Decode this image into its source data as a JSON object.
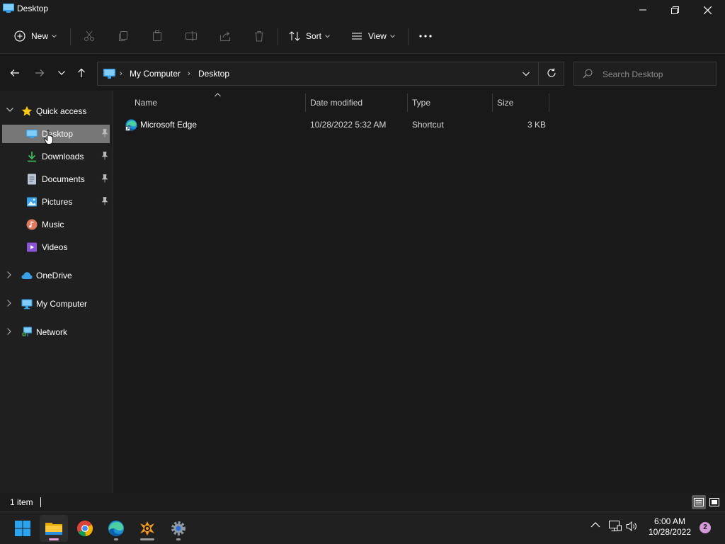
{
  "window": {
    "title": "Desktop"
  },
  "toolbar": {
    "new_label": "New",
    "sort_label": "Sort",
    "view_label": "View",
    "more_label": "···",
    "caret": "⌄"
  },
  "address": {
    "crumbs": [
      "My Computer",
      "Desktop"
    ],
    "separator": "›"
  },
  "search": {
    "placeholder": "Search Desktop"
  },
  "sidebar": {
    "items": [
      {
        "label": "Quick access",
        "icon": "star-icon"
      },
      {
        "label": "Desktop",
        "icon": "desktop-icon",
        "pinned": true,
        "selected": true
      },
      {
        "label": "Downloads",
        "icon": "download-icon",
        "pinned": true
      },
      {
        "label": "Documents",
        "icon": "document-icon",
        "pinned": true
      },
      {
        "label": "Pictures",
        "icon": "pictures-icon",
        "pinned": true
      },
      {
        "label": "Music",
        "icon": "music-icon"
      },
      {
        "label": "Videos",
        "icon": "videos-icon"
      },
      {
        "label": "OneDrive",
        "icon": "cloud-icon"
      },
      {
        "label": "My Computer",
        "icon": "computer-icon"
      },
      {
        "label": "Network",
        "icon": "network-icon"
      }
    ]
  },
  "columns": {
    "name": "Name",
    "date": "Date modified",
    "type": "Type",
    "size": "Size"
  },
  "files": [
    {
      "name": "Microsoft Edge",
      "date": "10/28/2022 5:32 AM",
      "type": "Shortcut",
      "size": "3 KB",
      "icon": "edge-shortcut-icon"
    }
  ],
  "status": {
    "count": "1 item"
  },
  "taskbar": {
    "apps": [
      "start-icon",
      "file-explorer-icon",
      "chrome-icon",
      "edge-icon",
      "app-icon",
      "settings-icon"
    ],
    "time": "6:00 AM",
    "date": "10/28/2022",
    "notifications": "2"
  },
  "colors": {
    "selection": "#777777",
    "background": "#191919",
    "accent": "#60cdff"
  }
}
